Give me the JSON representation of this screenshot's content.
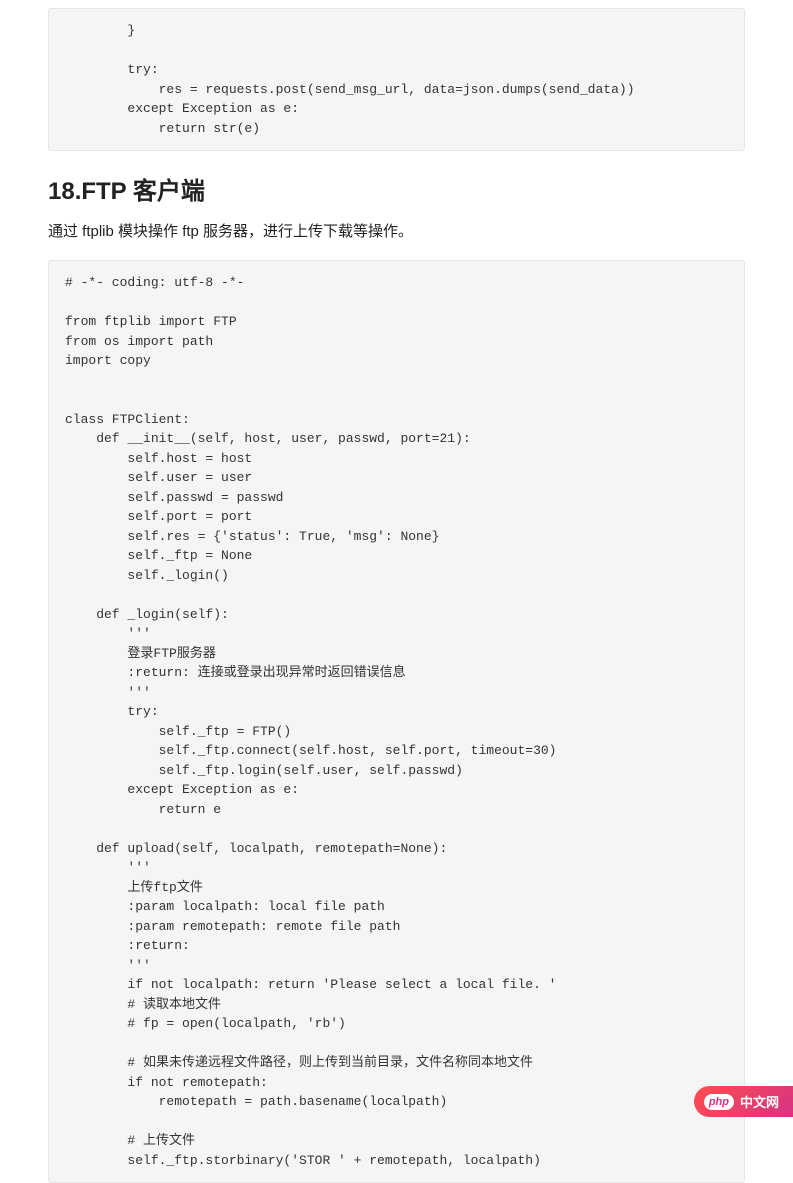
{
  "code_block_1": "        }\n\n        try:\n            res = requests.post(send_msg_url, data=json.dumps(send_data))\n        except Exception as e:\n            return str(e)",
  "heading": "18.FTP 客户端",
  "paragraph": "通过 ftplib 模块操作 ftp 服务器，进行上传下载等操作。",
  "code_block_2": "# -*- coding: utf-8 -*-\n\nfrom ftplib import FTP\nfrom os import path\nimport copy\n\n\nclass FTPClient:\n    def __init__(self, host, user, passwd, port=21):\n        self.host = host\n        self.user = user\n        self.passwd = passwd\n        self.port = port\n        self.res = {'status': True, 'msg': None}\n        self._ftp = None\n        self._login()\n\n    def _login(self):\n        '''\n        登录FTP服务器\n        :return: 连接或登录出现异常时返回错误信息\n        '''\n        try:\n            self._ftp = FTP()\n            self._ftp.connect(self.host, self.port, timeout=30)\n            self._ftp.login(self.user, self.passwd)\n        except Exception as e:\n            return e\n\n    def upload(self, localpath, remotepath=None):\n        '''\n        上传ftp文件\n        :param localpath: local file path\n        :param remotepath: remote file path\n        :return:\n        '''\n        if not localpath: return 'Please select a local file. '\n        # 读取本地文件\n        # fp = open(localpath, 'rb')\n\n        # 如果未传递远程文件路径，则上传到当前目录，文件名称同本地文件\n        if not remotepath:\n            remotepath = path.basename(localpath)\n\n        # 上传文件\n        self._ftp.storbinary('STOR ' + remotepath, localpath)",
  "footer": {
    "logo_text": "php",
    "label": "中文网"
  }
}
